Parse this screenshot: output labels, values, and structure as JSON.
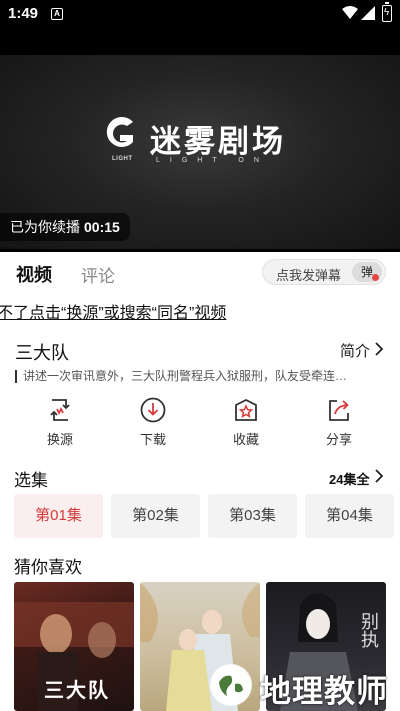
{
  "status_bar": {
    "time": "1:49",
    "notification_letter": "A"
  },
  "video": {
    "logo_title": "迷雾剧场",
    "logo_subtitle": "LIGHT ON",
    "logo_mark_text": "LIGHT",
    "resume_label": "已为你续播",
    "resume_time": "00:15"
  },
  "tabs": {
    "video": "视频",
    "comment": "评论",
    "danmaku_placeholder": "点我发弹幕",
    "danmaku_button": "弹"
  },
  "notice": "不了点击“换源”或搜索“同名”视频",
  "show": {
    "title": "三大队",
    "intro_label": "简介",
    "description": "讲述一次审讯意外，三大队刑警程兵入狱服刑，队友受牵连…"
  },
  "actions": [
    {
      "label": "换源",
      "icon": "switch-source-icon"
    },
    {
      "label": "下载",
      "icon": "download-icon"
    },
    {
      "label": "收藏",
      "icon": "favorite-icon"
    },
    {
      "label": "分享",
      "icon": "share-icon"
    }
  ],
  "episodes": {
    "title": "选集",
    "all_label": "24集全",
    "items": [
      "第01集",
      "第02集",
      "第03集",
      "第04集"
    ],
    "active_index": 0,
    "accent_color": "#d53b3b"
  },
  "recommend": {
    "title": "猜你喜欢",
    "poster_1_text": "三大队",
    "poster_3_text": "别执"
  },
  "watermark": "地理教师"
}
